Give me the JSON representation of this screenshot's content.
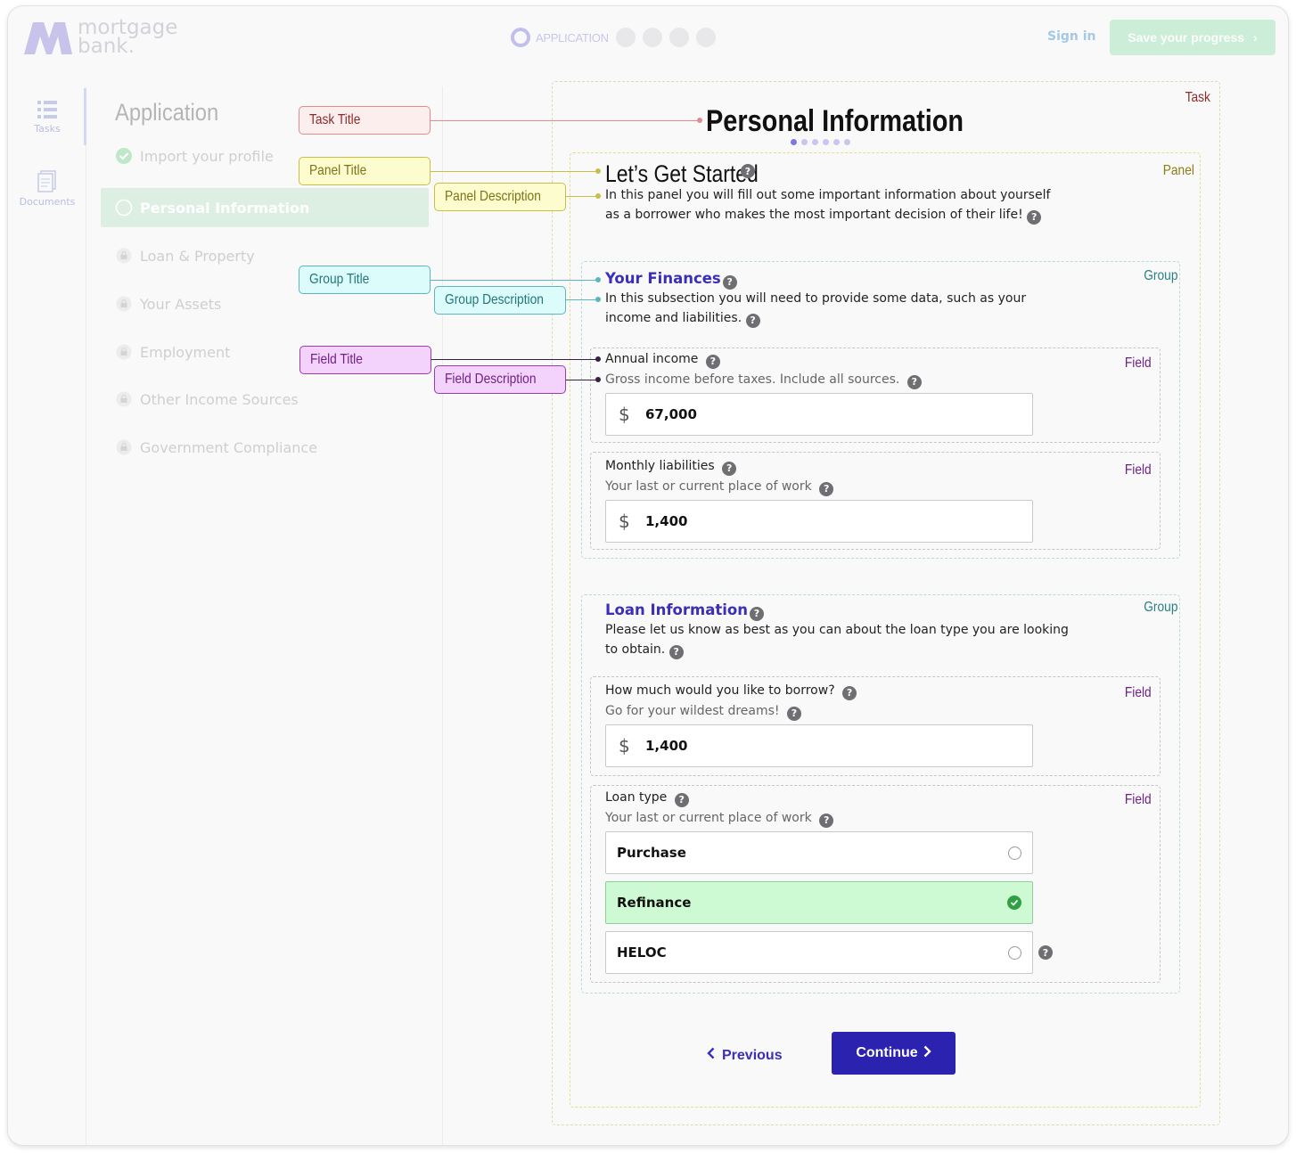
{
  "header": {
    "logo_line1": "mortgage",
    "logo_line2": "bank.",
    "progress_label": "APPLICATION",
    "signin_label": "Sign in",
    "save_label": "Save your progress"
  },
  "rail": {
    "tasks_label": "Tasks",
    "documents_label": "Documents"
  },
  "sidenav": {
    "title": "Application",
    "items": [
      {
        "label": "Import your profile",
        "state": "done"
      },
      {
        "label": "Personal Information",
        "state": "active"
      },
      {
        "label": "Loan & Property",
        "state": "locked"
      },
      {
        "label": "Your Assets",
        "state": "locked"
      },
      {
        "label": "Employment",
        "state": "locked"
      },
      {
        "label": "Other Income Sources",
        "state": "locked"
      },
      {
        "label": "Government Compliance",
        "state": "locked"
      }
    ]
  },
  "annotations": {
    "task_title": "Task Title",
    "panel_title": "Panel Title",
    "panel_description": "Panel Description",
    "group_title": "Group Title",
    "group_description": "Group Description",
    "field_title": "Field Title",
    "field_description": "Field Description",
    "box_task": "Task",
    "box_panel": "Panel",
    "box_group": "Group",
    "box_field": "Field"
  },
  "colors": {
    "primary": "#2b23b0",
    "group_title": "#3a2fb8",
    "selected_option": "#cdf9d3",
    "check": "#2fa043"
  },
  "task": {
    "title": "Personal Information",
    "panel": {
      "title": "Let’s Get Started",
      "description_line1": "In this panel you will fill out some important information about yourself",
      "description_line2": "as a borrower who makes the most important decision of their life!"
    },
    "groups": [
      {
        "title": "Your Finances",
        "description_line1": "In this subsection you will need to provide some data, such as your",
        "description_line2": "income and liabilities.",
        "fields": [
          {
            "title": "Annual income",
            "description": "Gross income before taxes. Include all sources.",
            "currency": "$",
            "value": "67,000"
          },
          {
            "title": "Monthly liabilities",
            "description": "Your last or current place of work",
            "currency": "$",
            "value": "1,400"
          }
        ]
      },
      {
        "title": "Loan Information",
        "description_line1": "Please let us know as best as you can about the loan type you are looking",
        "description_line2": "to obtain.",
        "fields": [
          {
            "title": "How much would you like to borrow?",
            "description": "Go for your wildest dreams!",
            "currency": "$",
            "value": "1,400"
          },
          {
            "title": "Loan type",
            "description": "Your last or current place of work",
            "options": [
              "Purchase",
              "Refinance",
              "HELOC"
            ],
            "selected": "Refinance"
          }
        ]
      }
    ]
  },
  "nav": {
    "previous_label": "Previous",
    "continue_label": "Continue"
  }
}
